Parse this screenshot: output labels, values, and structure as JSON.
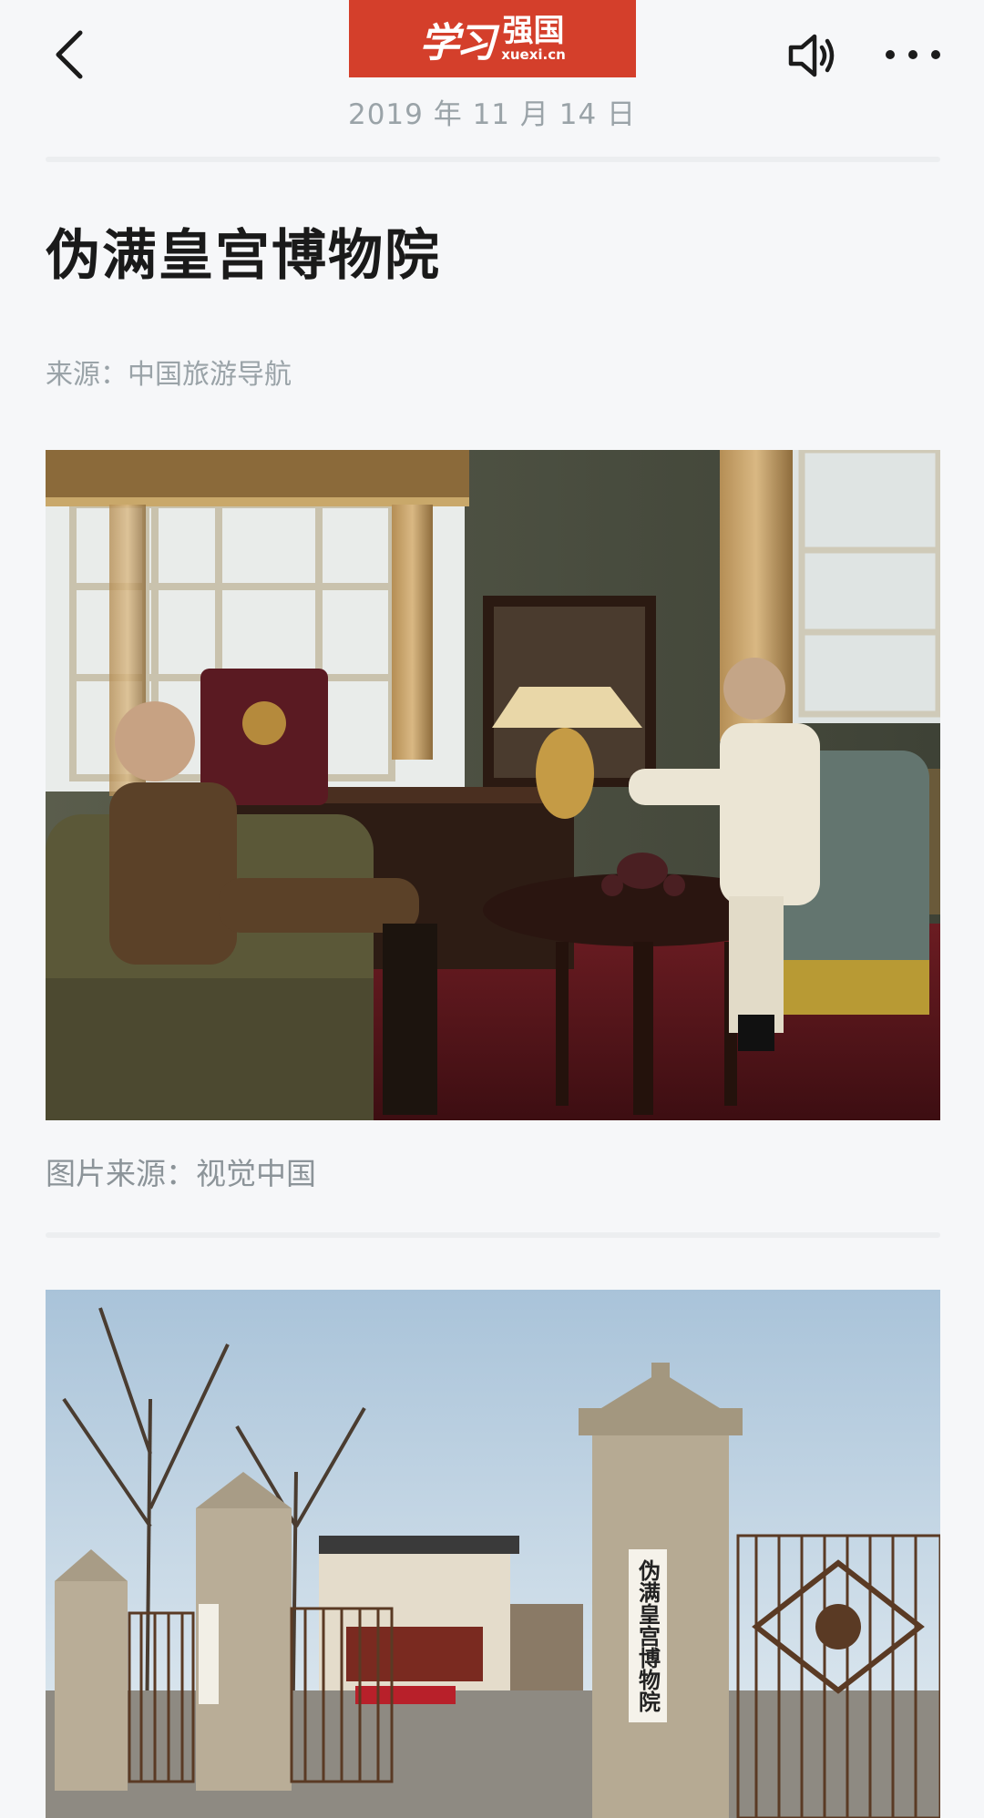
{
  "header": {
    "back_icon": "chevron-left-icon",
    "logo": {
      "script_text": "学习",
      "name": "强国",
      "url": "xuexi.cn",
      "bg_color": "#d43f2b"
    },
    "audio_icon": "speaker-icon",
    "more_icon": "more-horizontal-icon"
  },
  "article": {
    "date": "2019 年 11 月 14 日",
    "title": "伪满皇宫博物院",
    "source": "来源：中国旅游导航",
    "image1": {
      "description": "interior-reception-room-with-wax-figures",
      "caption": "图片来源：视觉中国"
    },
    "image2": {
      "description": "museum-gate-exterior",
      "sign_text": "伪满皇宫博物院"
    }
  },
  "colors": {
    "background": "#f6f7f9",
    "muted_text": "#9aa3a8",
    "title_text": "#1a1a1a"
  }
}
